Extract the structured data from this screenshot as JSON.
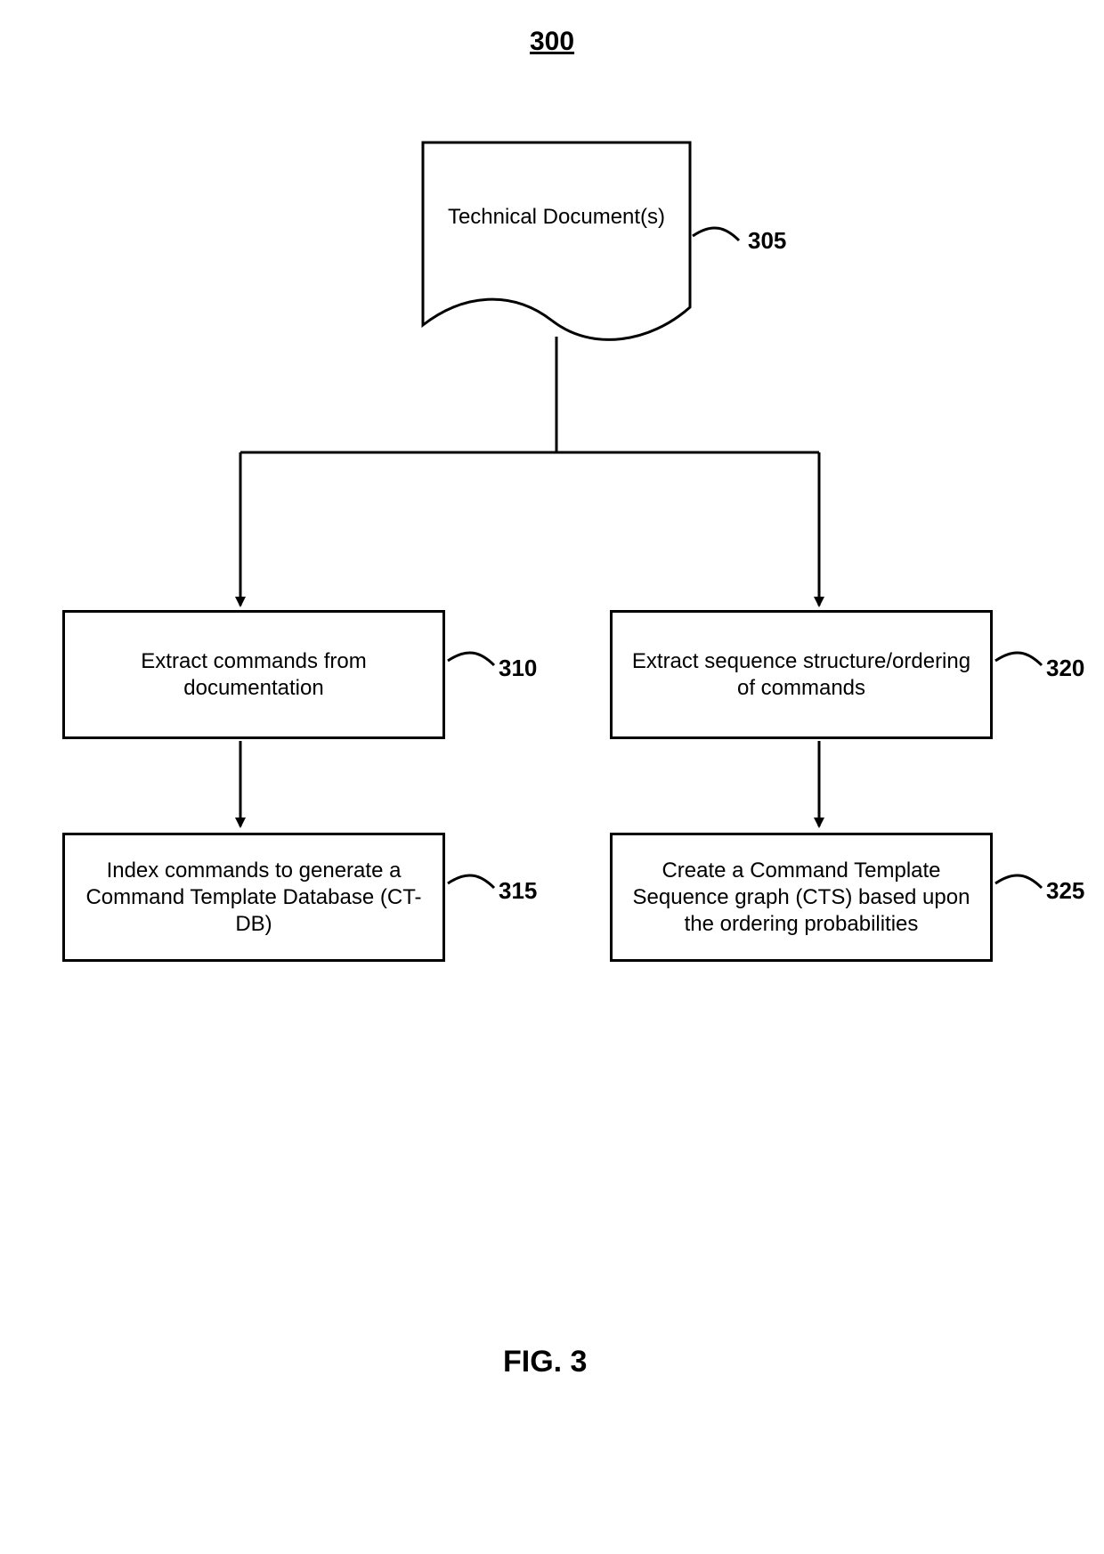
{
  "figure": {
    "number_label": "300",
    "caption": "FIG. 3"
  },
  "nodes": {
    "doc": {
      "text": "Technical Document(s)",
      "ref": "305"
    },
    "extract_commands": {
      "text": "Extract commands from documentation",
      "ref": "310"
    },
    "index_commands": {
      "text": "Index commands to generate a Command Template Database (CT-DB)",
      "ref": "315"
    },
    "extract_sequence": {
      "text": "Extract sequence structure/ordering of commands",
      "ref": "320"
    },
    "create_cts": {
      "text": "Create a Command Template Sequence graph (CTS) based upon the ordering probabilities",
      "ref": "325"
    }
  }
}
